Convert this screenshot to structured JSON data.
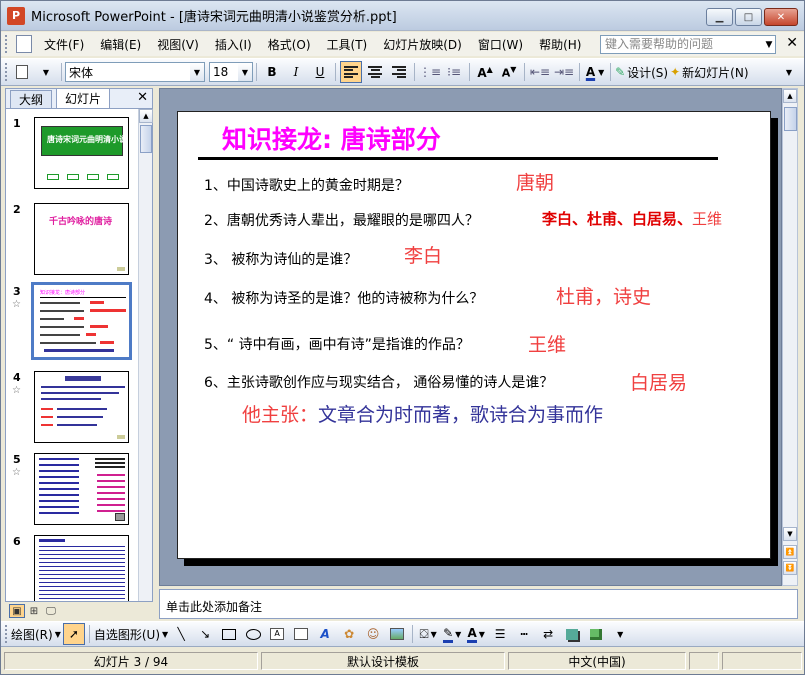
{
  "window": {
    "title": "Microsoft PowerPoint - [唐诗宋词元曲明清小说鉴赏分析.ppt]",
    "app_icon": "powerpoint-icon"
  },
  "menu": {
    "items": [
      "文件(F)",
      "编辑(E)",
      "视图(V)",
      "插入(I)",
      "格式(O)",
      "工具(T)",
      "幻灯片放映(D)",
      "窗口(W)",
      "帮助(H)"
    ],
    "help_placeholder": "键入需要帮助的问题"
  },
  "toolbar": {
    "font": "宋体",
    "size": "18",
    "bold": "B",
    "italic": "I",
    "underline": "U",
    "design": "设计(S)",
    "new_slide": "新幻灯片(N)",
    "font_color_label": "A"
  },
  "panel": {
    "tab_outline": "大纲",
    "tab_slides": "幻灯片",
    "selected_slide": 3,
    "thumbs": [
      {
        "num": "1",
        "star": "",
        "title": "唐诗宋词元曲明清小说"
      },
      {
        "num": "2",
        "star": "",
        "title": "千古吟咏的唐诗"
      },
      {
        "num": "3",
        "star": "☆",
        "title": "知识接龙：唐诗部分"
      },
      {
        "num": "4",
        "star": "☆",
        "title": "初唐四杰"
      },
      {
        "num": "5",
        "star": "☆",
        "title": "诗人介绍"
      },
      {
        "num": "6",
        "star": "",
        "title": "作品鉴赏"
      }
    ]
  },
  "slide": {
    "title": "知识接龙: 唐诗部分",
    "q1": "1、中国诗歌史上的黄金时期是？",
    "a1": "唐朝",
    "q2": "2、唐朝优秀诗人辈出，最耀眼的是哪四人？",
    "a2_red": "李白、杜甫、白居易、",
    "a2_pink": "王维",
    "q3": "3、  被称为诗仙的是谁？",
    "a3": "李白",
    "q4": "4、  被称为诗圣的是谁？他的诗被称为什么？",
    "a4": "杜甫，诗史",
    "q5": "5、“ 诗中有画，画中有诗”是指谁的作品？",
    "a5": "王维",
    "q6": "6、主张诗歌创作应与现实结合，  通俗易懂的诗人是谁？",
    "a6": "白居易",
    "claim_label": "他主张：",
    "claim_text": "文章合为时而著，歌诗合为事而作"
  },
  "notes": {
    "placeholder": "单击此处添加备注"
  },
  "drawbar": {
    "draw": "绘图(R)",
    "autoshapes": "自选图形(U)"
  },
  "status": {
    "slide": "幻灯片 3 / 94",
    "template": "默认设计模板",
    "language": "中文(中国)"
  },
  "colors": {
    "title_magenta": "#ff00ff",
    "answer_red": "#f04040",
    "deep_red": "#e00000",
    "claim_blue": "#333399"
  }
}
